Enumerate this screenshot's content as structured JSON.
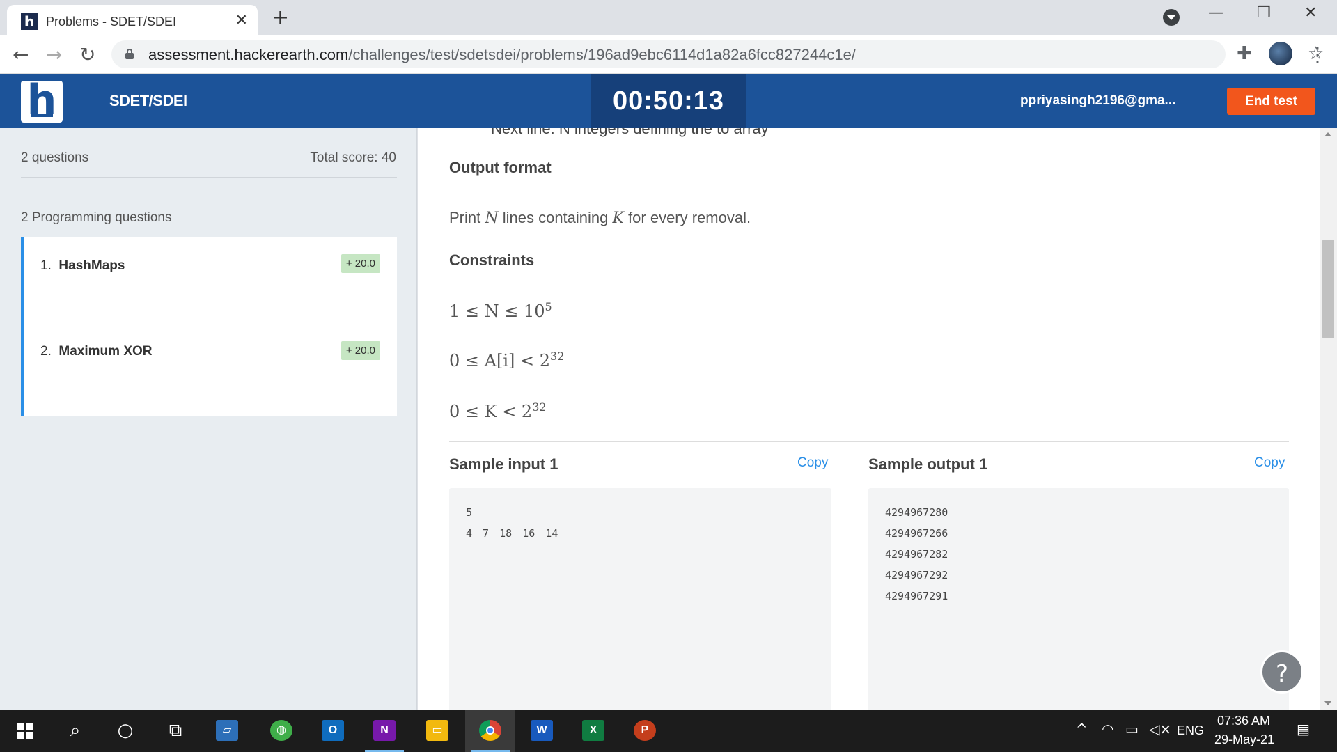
{
  "browser": {
    "tab_title": "Problems - SDET/SDEI",
    "tab_favicon": "h",
    "url_host": "assessment.hackerearth.com",
    "url_path": "/challenges/test/sdetsdei/problems/196ad9ebc6114d1a82a6fcc827244c1e/"
  },
  "header": {
    "logo": "h",
    "test_name": "SDET/SDEI",
    "timer": "00:50:13",
    "email": "ppriyasingh2196@gma...",
    "end_test_label": "End test",
    "brand_color": "#1c5399",
    "accent_color": "#f2561c"
  },
  "sidebar": {
    "question_count": "2 questions",
    "total_score": "Total score: 40",
    "section_label": "2 Programming questions",
    "questions": [
      {
        "number": "1.",
        "title": "HashMaps",
        "score": "+ 20.0"
      },
      {
        "number": "2.",
        "title": "Maximum XOR",
        "score": "+ 20.0"
      }
    ]
  },
  "problem": {
    "cut_line": "Next line: N integers defining the to array",
    "output_heading": "Output format",
    "output_text": {
      "p1": "Print ",
      "var1": "N",
      "p2": " lines containing ",
      "var2": "K",
      "p3": " for every removal."
    },
    "constraints_heading": "Constraints",
    "constraints": [
      {
        "lhs": "1 ≤ N ≤ 10",
        "sup": "5"
      },
      {
        "lhs": "0 ≤ A[i] < 2",
        "sup": "32"
      },
      {
        "lhs": "0 ≤ K < 2",
        "sup": "32"
      }
    ],
    "sample_input_heading": "Sample input 1",
    "sample_output_heading": "Sample output 1",
    "copy_label": "Copy",
    "sample_input_lines": [
      "5",
      "4 7 18 16 14"
    ],
    "sample_output_lines": [
      "4294967280",
      "4294967266",
      "4294967282",
      "4294967292",
      "4294967291"
    ]
  },
  "taskbar": {
    "time": "07:36 AM",
    "date": "29-May-21",
    "language": "ENG",
    "apps": [
      "windows-start",
      "search",
      "cortana",
      "task-view",
      "laptop",
      "app-globe",
      "outlook",
      "onenote",
      "file-explorer",
      "chrome",
      "word",
      "excel",
      "powerpoint"
    ]
  }
}
